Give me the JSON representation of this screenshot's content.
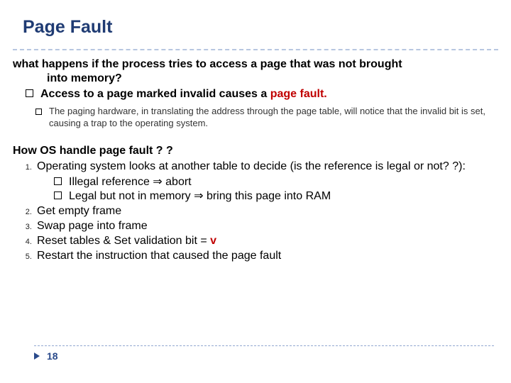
{
  "title": "Page Fault",
  "question": {
    "line1": "what happens if the process tries to access a page that was not brought",
    "line2": "into memory?"
  },
  "access": {
    "prefix": "Access to a page marked invalid causes a ",
    "highlight": "page fault."
  },
  "sub_note": "The paging hardware, in translating the address through the page table, will notice that the invalid bit is set, causing a trap to the operating system.",
  "how_title": "How OS handle page fault ? ?",
  "steps": {
    "s1": "Operating system looks at another table to decide (is the reference is legal or not? ?):",
    "s1a_pre": "Illegal reference ",
    "s1a_post": " abort",
    "s1b_pre": "Legal but not in memory ",
    "s1b_post": " bring this page into RAM",
    "s2": "Get empty frame",
    "s3": "Swap page into frame",
    "s4_pre": "Reset tables & Set validation bit = ",
    "s4_v": "v",
    "s5": "Restart the instruction that caused the page fault"
  },
  "arrow": "⇒",
  "page_number": "18"
}
